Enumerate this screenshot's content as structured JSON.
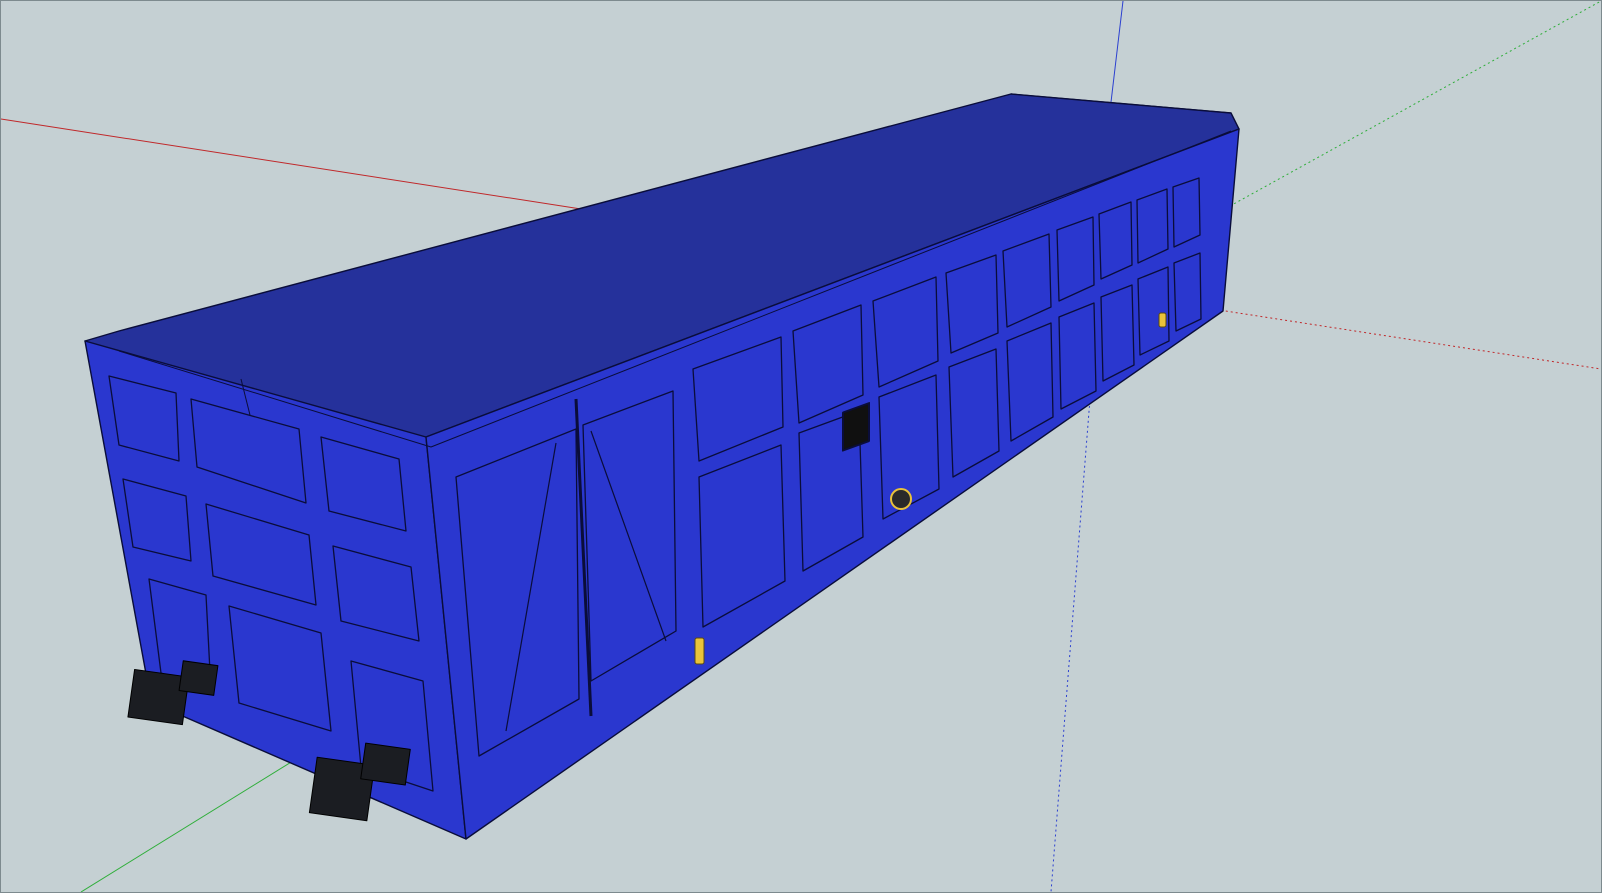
{
  "viewport": {
    "background": "#c5d0d3",
    "border": "#7d8a8e"
  },
  "axes": {
    "red": "#c0282a",
    "green": "#2fae3a",
    "blue": "#2b3fd0"
  },
  "model": {
    "body_color": "#2a37cf",
    "top_face_color": "#25319b",
    "outline_color": "#0a0d3a",
    "buffer_color": "#1b1d22",
    "hardware_color": "#e9c23a"
  }
}
